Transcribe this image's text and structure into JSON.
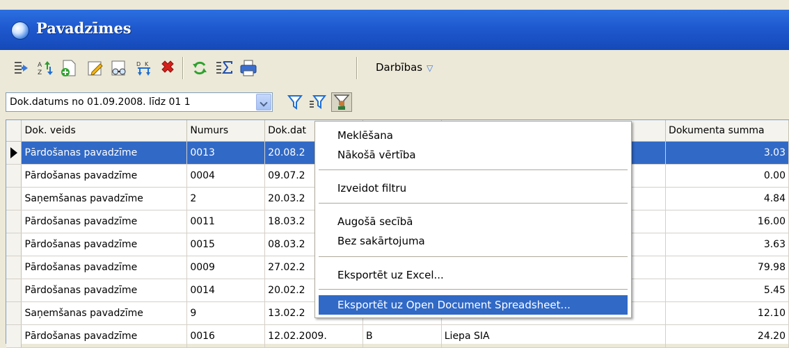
{
  "window": {
    "title": "Pavadzīmes"
  },
  "toolbar": {
    "icons": [
      "list-arrow-icon",
      "sort-az-icon",
      "new-document-icon",
      "edit-pencil-icon",
      "glasses-view-icon",
      "dk-transfer-icon",
      "delete-x-icon",
      "refresh-icon",
      "sum-icon",
      "print-icon"
    ],
    "actions_label": "Darbības",
    "actions_arrow": "▽"
  },
  "filter": {
    "value": "Dok.datums no 01.09.2008. līdz 01 1"
  },
  "grid": {
    "columns": [
      {
        "label": "Dok. veids"
      },
      {
        "label": "Numurs"
      },
      {
        "label": "Dok.dat"
      },
      {
        "label": ""
      },
      {
        "label": ""
      },
      {
        "label": "Dokumenta summa"
      }
    ],
    "rows": [
      {
        "veids": "Pārdošanas pavadzīme",
        "numurs": "0013",
        "datums": "20.08.2",
        "c4": "",
        "c5": "",
        "summa": "3.03",
        "selected": true
      },
      {
        "veids": "Pārdošanas pavadzīme",
        "numurs": "0004",
        "datums": "09.07.2",
        "c4": "",
        "c5": "",
        "summa": "0.00"
      },
      {
        "veids": "Saņemšanas pavadzīme",
        "numurs": "2",
        "datums": "20.03.2",
        "c4": "",
        "c5": "",
        "summa": "4.84"
      },
      {
        "veids": "Pārdošanas pavadzīme",
        "numurs": "0011",
        "datums": "18.03.2",
        "c4": "",
        "c5": "",
        "summa": "16.00"
      },
      {
        "veids": "Pārdošanas pavadzīme",
        "numurs": "0015",
        "datums": "08.03.2",
        "c4": "",
        "c5": "",
        "summa": "3.63"
      },
      {
        "veids": "Pārdošanas pavadzīme",
        "numurs": "0009",
        "datums": "27.02.2",
        "c4": "",
        "c5": "",
        "summa": "79.98"
      },
      {
        "veids": "Pārdošanas pavadzīme",
        "numurs": "0014",
        "datums": "20.02.2",
        "c4": "",
        "c5": "",
        "summa": "5.45"
      },
      {
        "veids": "Saņemšanas pavadzīme",
        "numurs": "9",
        "datums": "13.02.2",
        "c4": "",
        "c5": "",
        "summa": "12.10"
      },
      {
        "veids": "Pārdošanas pavadzīme",
        "numurs": "0016",
        "datums": "12.02.2009.",
        "c4": "B",
        "c5": "Liepa SIA",
        "summa": "24.20"
      }
    ]
  },
  "context_menu": {
    "items": [
      {
        "label": "Meklēšana"
      },
      {
        "label": "Nākošā vērtība"
      },
      {
        "label": "Izveidot filtru"
      },
      {
        "label": "Augošā secībā"
      },
      {
        "label": "Bez sakārtojuma"
      },
      {
        "label": "Eksportēt uz Excel..."
      },
      {
        "label": "Eksportēt uz Open Document Spreadsheet...",
        "highlighted": true
      }
    ]
  },
  "colors": {
    "selection": "#3169c6",
    "titlebar": "#1f59cf",
    "window_bg": "#ece9d8"
  }
}
